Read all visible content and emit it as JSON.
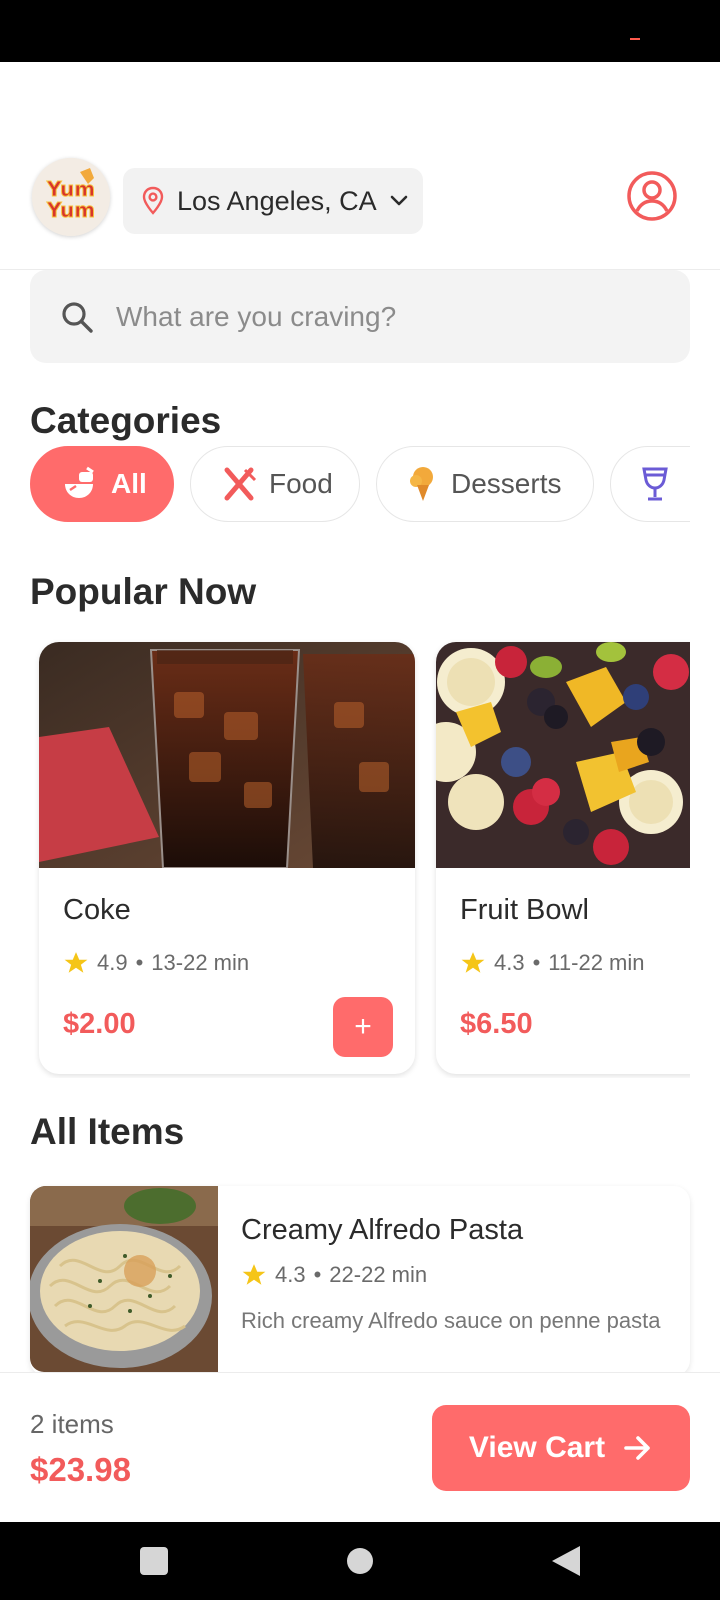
{
  "header": {
    "logo_text_top": "Yum",
    "logo_text_bottom": "Yum",
    "location": "Los Angeles, CA",
    "icons": {
      "location": "map-pin-icon",
      "dropdown": "chevron-down-icon",
      "profile": "user-circle-icon"
    }
  },
  "search": {
    "placeholder": "What are you craving?",
    "icon": "search-icon"
  },
  "categories": {
    "title": "Categories",
    "items": [
      {
        "label": "All",
        "icon": "bowl-icon",
        "active": true
      },
      {
        "label": "Food",
        "icon": "utensils-icon",
        "active": false
      },
      {
        "label": "Desserts",
        "icon": "ice-cream-icon",
        "active": false
      },
      {
        "label": "",
        "icon": "wine-glass-icon",
        "active": false
      }
    ]
  },
  "popular": {
    "title": "Popular Now",
    "items": [
      {
        "name": "Coke",
        "rating": "4.9",
        "time": "13-22 min",
        "price": "$2.00",
        "add_label": "+"
      },
      {
        "name": "Fruit Bowl",
        "rating": "4.3",
        "time": "11-22 min",
        "price": "$6.50"
      }
    ]
  },
  "all_items": {
    "title": "All Items",
    "items": [
      {
        "name": "Creamy Alfredo Pasta",
        "rating": "4.3",
        "time": "22-22 min",
        "description": "Rich creamy Alfredo sauce on penne pasta"
      }
    ]
  },
  "cart": {
    "count": "2 items",
    "total": "$23.98",
    "button_label": "View Cart"
  },
  "colors": {
    "accent": "#ff6b6b",
    "price": "#f25b5b",
    "star": "#f5c518"
  }
}
